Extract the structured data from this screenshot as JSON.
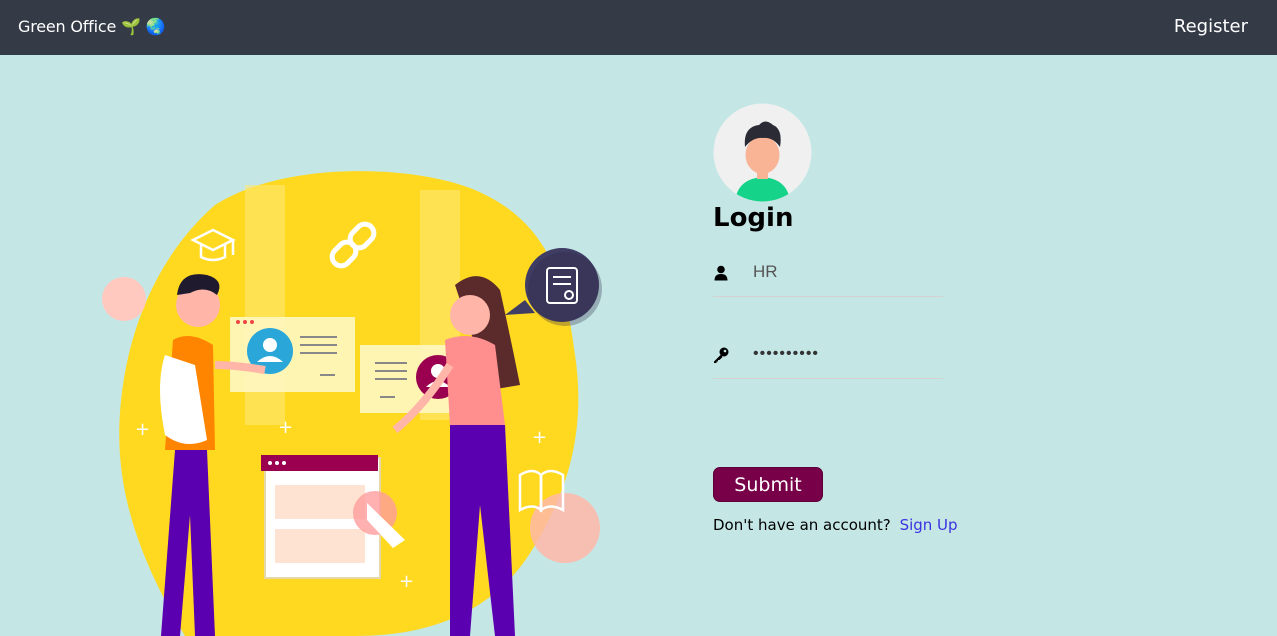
{
  "navbar": {
    "brand": "Green Office 🌱 🌏",
    "register_label": "Register"
  },
  "illustration": {
    "name": "teamwork-illustration"
  },
  "login": {
    "title": "Login",
    "username_value": "HR",
    "username_icon": "user-icon",
    "password_value": "••••••••••",
    "password_icon": "key-icon",
    "submit_label": "Submit",
    "signup_prompt": "Don't have an account?",
    "signup_link": "Sign Up"
  },
  "colors": {
    "navbar_bg": "#343a46",
    "page_bg": "#c4e7e6",
    "submit_bg": "#770048",
    "link": "#3b32e0",
    "blob_yellow": "#ffd920"
  }
}
